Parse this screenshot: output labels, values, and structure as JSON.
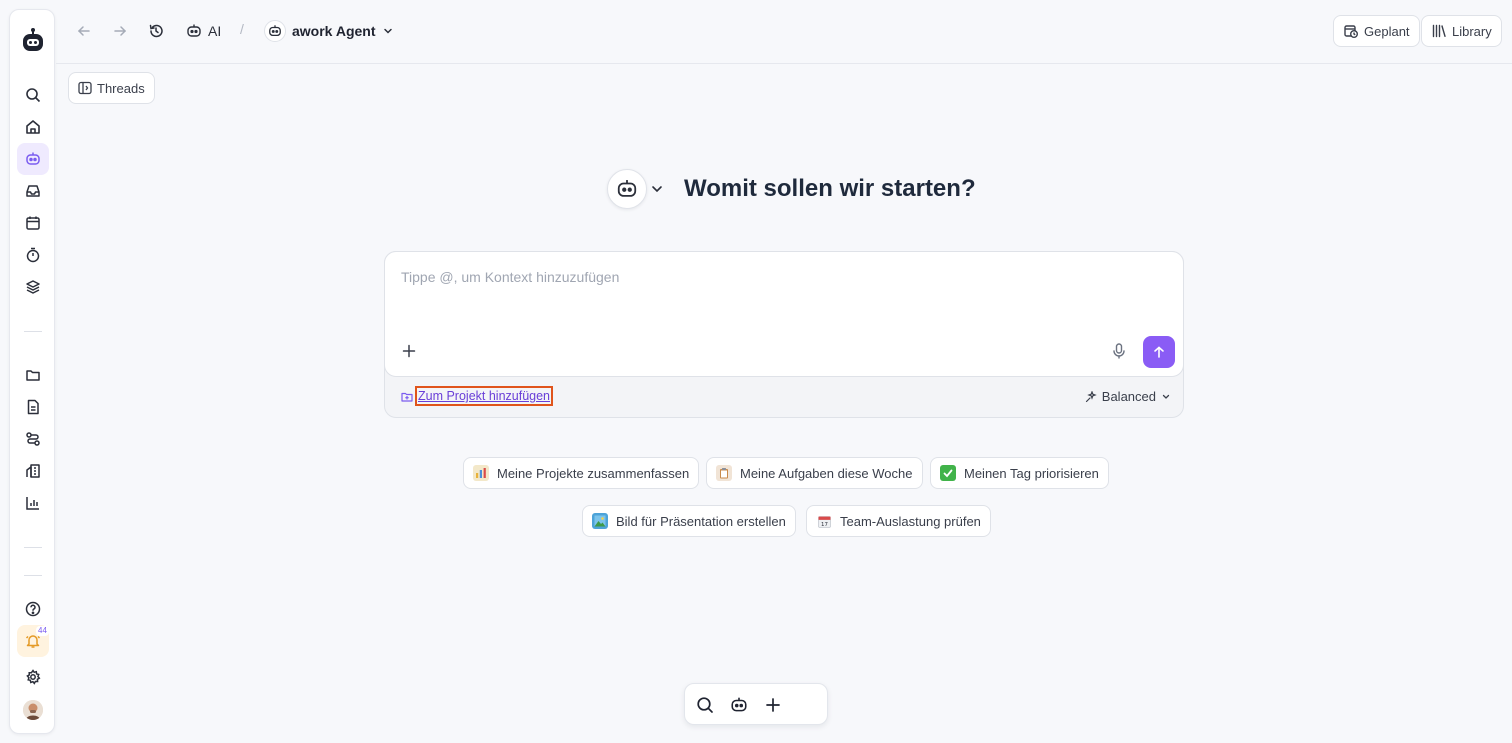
{
  "topbar": {
    "crumb_ai": "AI",
    "crumb_sep": "/",
    "agent_name": "awork Agent",
    "planned_label": "Geplant",
    "library_label": "Library"
  },
  "threads_label": "Threads",
  "hero": {
    "title": "Womit sollen wir starten?"
  },
  "composer": {
    "placeholder": "Tippe @, um Kontext hinzuzufügen",
    "add_project_label": "Zum Projekt hinzufügen",
    "mode_label": "Balanced"
  },
  "suggestions": [
    {
      "label": "Meine Projekte zusammenfassen",
      "icon": "bar-chart-icon",
      "color": "#e8b23a"
    },
    {
      "label": "Meine Aufgaben diese Woche",
      "icon": "clipboard-icon",
      "color": "#c98a4b"
    },
    {
      "label": "Meinen Tag priorisieren",
      "icon": "check-mark-icon",
      "color": "#41b34a"
    },
    {
      "label": "Bild für Präsentation erstellen",
      "icon": "picture-icon",
      "color": "#4da3d8"
    },
    {
      "label": "Team-Auslastung prüfen",
      "icon": "calendar-icon",
      "color": "#d94a4a"
    }
  ],
  "sidebar": {
    "notification_count": "44"
  },
  "colors": {
    "accent": "#8a5cf5",
    "background": "#f7f8fb",
    "highlight": "#e0541c"
  }
}
